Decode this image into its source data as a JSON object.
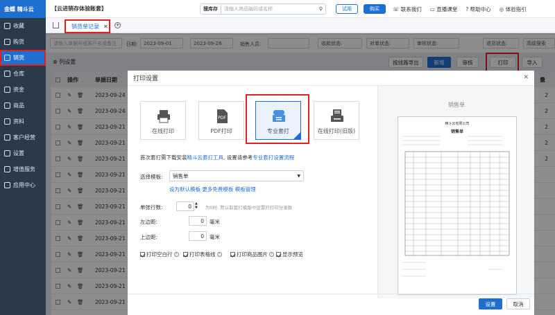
{
  "sidebar": {
    "logo": "金蝶 精斗云",
    "items": [
      {
        "label": "收藏"
      },
      {
        "label": "购货"
      },
      {
        "label": "销货"
      },
      {
        "label": "仓库"
      },
      {
        "label": "资金"
      },
      {
        "label": "商品"
      },
      {
        "label": "资料"
      },
      {
        "label": "客户经营"
      },
      {
        "label": "设置"
      },
      {
        "label": "增值服务"
      },
      {
        "label": "应用中心"
      }
    ]
  },
  "topbar": {
    "title": "【云进销存体验账套】",
    "search_label": "搜库存",
    "search_placeholder": "请输入商品编码或名称",
    "try_label": "试用",
    "buy_label": "购买",
    "links": [
      "联系我们",
      "直播课堂",
      "帮助中心",
      "体验指引"
    ]
  },
  "tabs": {
    "active": "销货单记录"
  },
  "filter": {
    "search_placeholder": "请输入单据号或客户名或备注",
    "date_label": "日期:",
    "date_from": "2023-09-01",
    "date_to": "2023-09-26",
    "sales_label": "销售人员:",
    "payment_label": "收款状态:",
    "check_label": "对单状态:",
    "audit_label": "审核状态:",
    "return_label": "退货状态:",
    "advanced_label": "高级搜索"
  },
  "toolbar": {
    "column_settings": "列设置",
    "route_export": "按线路导出",
    "new": "新增",
    "audit": "审核",
    "print": "打印",
    "import": "导入"
  },
  "table": {
    "headers": [
      "操作",
      "单据日期"
    ],
    "dates": [
      "2023-09-24",
      "2023-09-24",
      "2023-09-21",
      "2023-09-21",
      "2023-09-21",
      "2023-09-21",
      "2023-09-21",
      "2023-09-21",
      "2023-09-21",
      "2023-09-21",
      "2023-09-21",
      "2023-09-21",
      "2023-09-21",
      "2023-09-21"
    ],
    "qty_header": "量",
    "qty_values": [
      "2",
      "2",
      "2",
      "2",
      "2"
    ]
  },
  "modal": {
    "title": "打印设置",
    "options": [
      {
        "label": "在线打印"
      },
      {
        "label": "PDF打印",
        "badge": "PDF"
      },
      {
        "label": "专业套打"
      },
      {
        "label": "在线打印(旧版)"
      }
    ],
    "install_hint_pre": "首次套打需下载安装",
    "install_link": "精斗云套打工具",
    "install_hint_mid": ", 设置请参考",
    "install_flow_link": "专业套打设置流程",
    "template_label": "选择模板:",
    "template_value": "销售单",
    "template_links": [
      "设为默认模板",
      "更多免费模板",
      "模板管理"
    ],
    "copies_label": "单张行数:",
    "copies_value": "0",
    "copies_hint": "为0时, 默认取套打模版中设置的打印分录数",
    "left_margin_label": "左边距:",
    "left_margin_value": "0",
    "top_margin_label": "上边距:",
    "top_margin_value": "0",
    "unit": "毫米",
    "checkboxes": [
      {
        "label": "打印空白行",
        "checked": true
      },
      {
        "label": "打印表格线",
        "checked": true
      },
      {
        "label": "打印商品图片",
        "checked": true
      },
      {
        "label": "显示预览",
        "checked": true
      }
    ],
    "preview_title": "销售单",
    "paper_company": "精斗云有限公司",
    "paper_title": "销售单",
    "confirm": "设置",
    "cancel": "取消"
  }
}
